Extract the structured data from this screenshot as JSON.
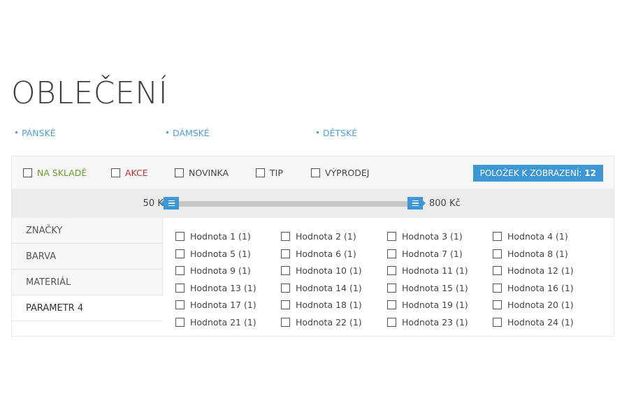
{
  "page": {
    "title": "OBLEČENÍ"
  },
  "subcategories": [
    "PÁNSKÉ",
    "DÁMSKÉ",
    "DĚTSKÉ"
  ],
  "flags": [
    {
      "label": "NA SKLADĚ",
      "style": "green"
    },
    {
      "label": "AKCE",
      "style": "red"
    },
    {
      "label": "NOVINKA",
      "style": "plain"
    },
    {
      "label": "TIP",
      "style": "plain"
    },
    {
      "label": "VÝPRODEJ",
      "style": "plain"
    }
  ],
  "count_button": {
    "label": "POLOŽEK K ZOBRAZENÍ:",
    "value": "12"
  },
  "price": {
    "min_label": "50 Kč",
    "max_label": "800 Kč"
  },
  "param_tabs": [
    {
      "label": "ZNAČKY",
      "active": false
    },
    {
      "label": "BARVA",
      "active": false
    },
    {
      "label": "MATERIÁL",
      "active": false
    },
    {
      "label": "PARAMETR 4",
      "active": true
    }
  ],
  "values": [
    "Hodnota 1 (1)",
    "Hodnota 2 (1)",
    "Hodnota 3 (1)",
    "Hodnota 4 (1)",
    "Hodnota 5 (1)",
    "Hodnota 6 (1)",
    "Hodnota 7 (1)",
    "Hodnota 8 (1)",
    "Hodnota 9 (1)",
    "Hodnota 10 (1)",
    "Hodnota 11 (1)",
    "Hodnota 12 (1)",
    "Hodnota 13 (1)",
    "Hodnota 14 (1)",
    "Hodnota 15 (1)",
    "Hodnota 16 (1)",
    "Hodnota 17 (1)",
    "Hodnota 18 (1)",
    "Hodnota 19 (1)",
    "Hodnota 20 (1)",
    "Hodnota 21 (1)",
    "Hodnota 22 (1)",
    "Hodnota 23 (1)",
    "Hodnota 24 (1)"
  ],
  "colors": {
    "accent": "#3d97d6",
    "link": "#4a9fd8",
    "instock": "#6b9c2c",
    "sale": "#cc2a2a"
  }
}
